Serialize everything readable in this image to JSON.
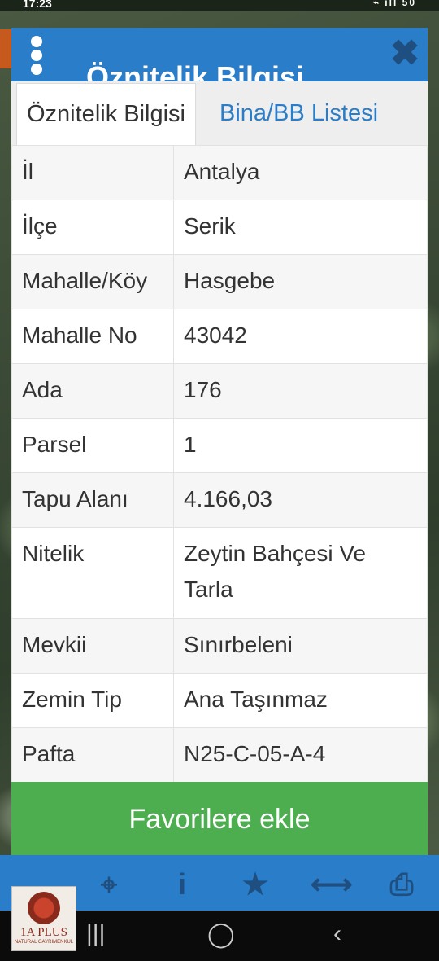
{
  "status_bar": {
    "time": "17:23",
    "icons": "⌁ ıll 50"
  },
  "dialog": {
    "title": "Öznitelik Bilgisi",
    "close_icon": "close-icon",
    "menu_icon": "kebab-menu-icon"
  },
  "tabs": [
    {
      "label": "Öznitelik Bilgisi",
      "active": true
    },
    {
      "label": "Bina/BB Listesi",
      "active": false
    }
  ],
  "attributes": [
    {
      "key": "İl",
      "value": "Antalya"
    },
    {
      "key": "İlçe",
      "value": "Serik"
    },
    {
      "key": "Mahalle/Köy",
      "value": "Hasgebe"
    },
    {
      "key": "Mahalle No",
      "value": "43042"
    },
    {
      "key": "Ada",
      "value": "176"
    },
    {
      "key": "Parsel",
      "value": "1"
    },
    {
      "key": "Tapu Alanı",
      "value": "4.166,03"
    },
    {
      "key": "Nitelik",
      "value": "Zeytin Bahçesi Ve Tarla"
    },
    {
      "key": "Mevkii",
      "value": "Sınırbeleni"
    },
    {
      "key": "Zemin Tip",
      "value": "Ana Taşınmaz"
    },
    {
      "key": "Pafta",
      "value": "N25-C-05-A-4"
    }
  ],
  "favorite_button": {
    "label": "Favorilere ekle"
  },
  "toolbar": {
    "icons": [
      "crosshair-icon",
      "info-icon",
      "star-icon",
      "measure-icon",
      "print-icon"
    ]
  },
  "logo": {
    "text": "1A PLUS",
    "sub": "NATURAL GAYRIMENKUL"
  },
  "colors": {
    "header": "#2a7dc8",
    "button": "#4cae4f",
    "tab_link": "#2a7dc8"
  }
}
